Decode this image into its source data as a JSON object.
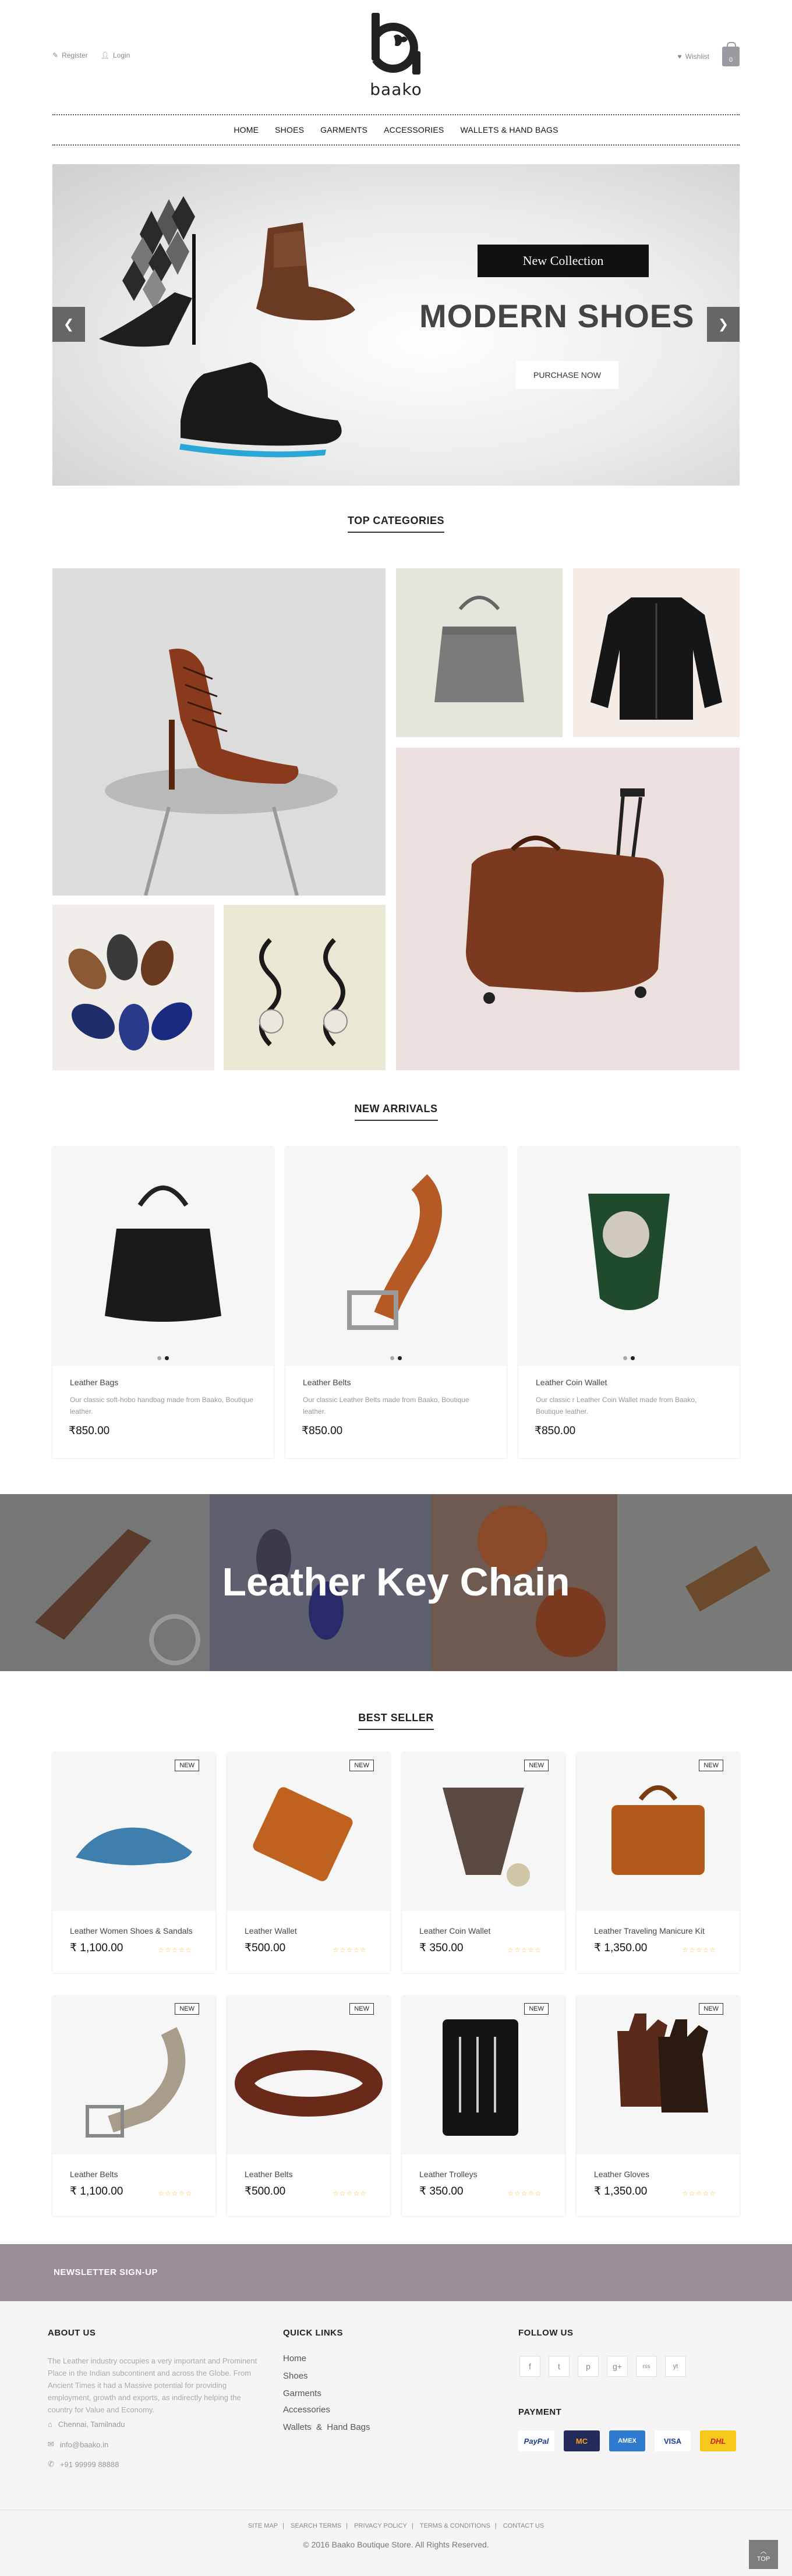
{
  "header": {
    "register": "Register",
    "login": "Login",
    "brand": "baako",
    "wishlist": "Wishlist",
    "cart_count": "0"
  },
  "nav": [
    "HOME",
    "SHOES",
    "GARMENTS",
    "ACCESSORIES",
    "WALLETS & HAND BAGS"
  ],
  "hero": {
    "badge": "New Collection",
    "title": "MODERN SHOES",
    "button": "PURCHASE NOW",
    "prev": "❮",
    "next": "❯"
  },
  "top_categories": {
    "title": "TOP CATEGORIES"
  },
  "new_arrivals": {
    "title": "NEW ARRIVALS",
    "items": [
      {
        "name": "Leather Bags",
        "desc": "Our classic soft-hobo handbag made from Baako, Boutique leather.",
        "price": "850.00"
      },
      {
        "name": "Leather Belts",
        "desc": "Our classic Leather Belts made from Baako, Boutique leather.",
        "price": "850.00"
      },
      {
        "name": "Leather Coin Wallet",
        "desc": "Our classic r Leather Coin Wallet made from Baako, Boutique leather.",
        "price": "850.00"
      }
    ]
  },
  "banner": {
    "title": "Leather Key Chain"
  },
  "best_seller": {
    "title": "BEST SELLER",
    "badge": "NEW",
    "items": [
      {
        "name": "Leather Women Shoes & Sandals",
        "price": "1,100.00"
      },
      {
        "name": "Leather Wallet",
        "price": "500.00"
      },
      {
        "name": "Leather Coin Wallet",
        "price": "350.00"
      },
      {
        "name": "Leather Traveling Manicure Kit",
        "price": "1,350.00"
      },
      {
        "name": "Leather Belts",
        "price": "1,100.00"
      },
      {
        "name": "Leather Belts",
        "price": "500.00"
      },
      {
        "name": "Leather Trolleys",
        "price": "350.00"
      },
      {
        "name": "Leather Gloves",
        "price": "1,350.00"
      }
    ]
  },
  "newsletter": {
    "title": "NEWSLETTER SIGN-UP"
  },
  "footer": {
    "about_title": "ABOUT US",
    "about_text": "The Leather industry occupies a very important and Prominent Place in the Indian subcontinent and across the Globe. From Ancient Times it had a Massive potential for providing employment, growth and exports, as indirectly helping the country for Value and Economy.",
    "location": "Chennai, Tamilnadu",
    "email": "info@baako.in",
    "phone": "+91 99999 88888",
    "quick_title": "QUICK LINKS",
    "quick_links": [
      "Home",
      "Shoes",
      "Garments",
      "Accessories",
      "Wallets  &  Hand Bags"
    ],
    "follow_title": "FOLLOW US",
    "social": [
      "f",
      "t",
      "p",
      "g+",
      "rss",
      "yt"
    ],
    "payment_title": "PAYMENT",
    "payments": [
      "PayPal",
      "MC",
      "AMEX",
      "VISA",
      "DHL"
    ],
    "bottom_links": [
      "SITE MAP",
      "SEARCH TERMS",
      "PRIVACY POLICY",
      "TERMS & CONDITIONS",
      "CONTACT US"
    ],
    "copyright": "© 2016 Baako Boutique Store. All Rights Reserved.",
    "top": "TOP"
  },
  "colors": {
    "newsletter_bg": "#998d98",
    "star": "#f2c230",
    "footer_bg": "#f5f5f5"
  }
}
